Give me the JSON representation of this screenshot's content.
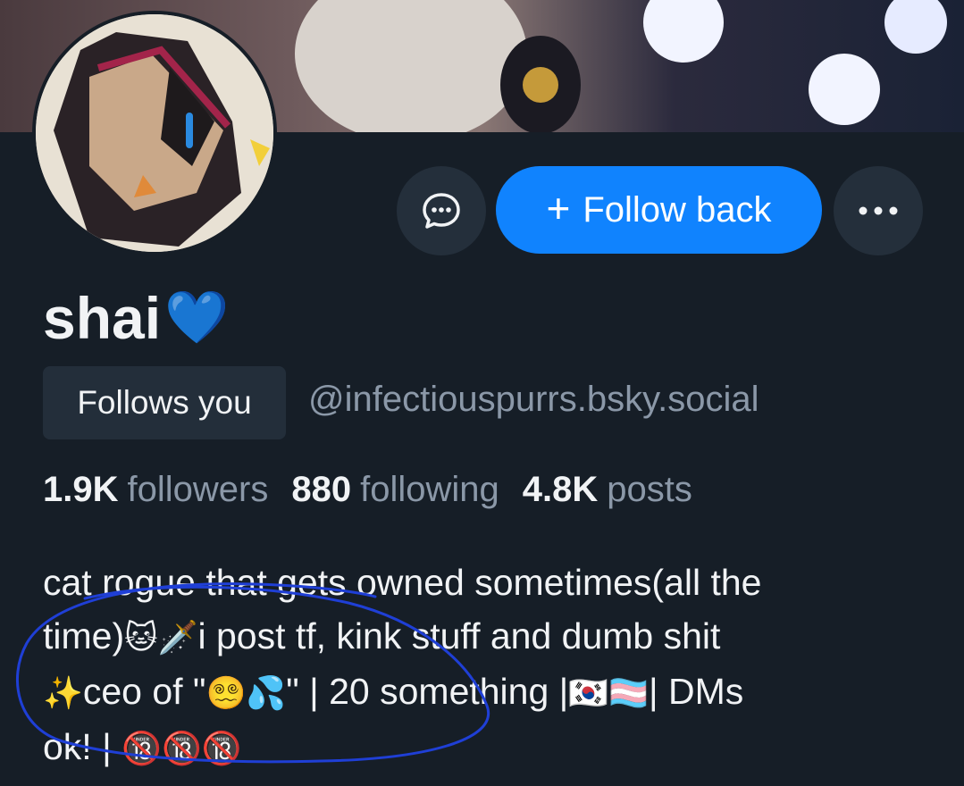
{
  "profile": {
    "display_name": "shai",
    "name_emoji": "💙",
    "follows_you_label": "Follows you",
    "handle": "@infectiouspurrs.bsky.social"
  },
  "actions": {
    "message_icon": "chat-bubble-icon",
    "follow_label": "Follow back",
    "follow_plus": "+",
    "more_icon": "more-horizontal-icon"
  },
  "stats": [
    {
      "value": "1.9K",
      "label": "followers"
    },
    {
      "value": "880",
      "label": "following"
    },
    {
      "value": "4.8K",
      "label": "posts"
    }
  ],
  "bio": {
    "line1": "cat rogue that gets owned sometimes(all the",
    "line2_text": "time)",
    "line2_emoji": "🐱🗡️",
    "line2_rest": "i post tf, kink stuff and dumb shit",
    "line3_emoji_start": "✨",
    "line3_a": "ceo of \"",
    "line3_emoji_mid": "😵‍💫💦",
    "line3_b": "\" | 20 something |",
    "line3_flags": "🇰🇷🏳️‍⚧️",
    "line3_c": "| DMs",
    "line4_a": "ok! |",
    "line4_emoji": "🔞🔞🔞"
  },
  "colors": {
    "background": "#161e27",
    "accent": "#1083fe",
    "muted_text": "#8b98a8",
    "annotation_stroke": "#1f3fd6"
  }
}
